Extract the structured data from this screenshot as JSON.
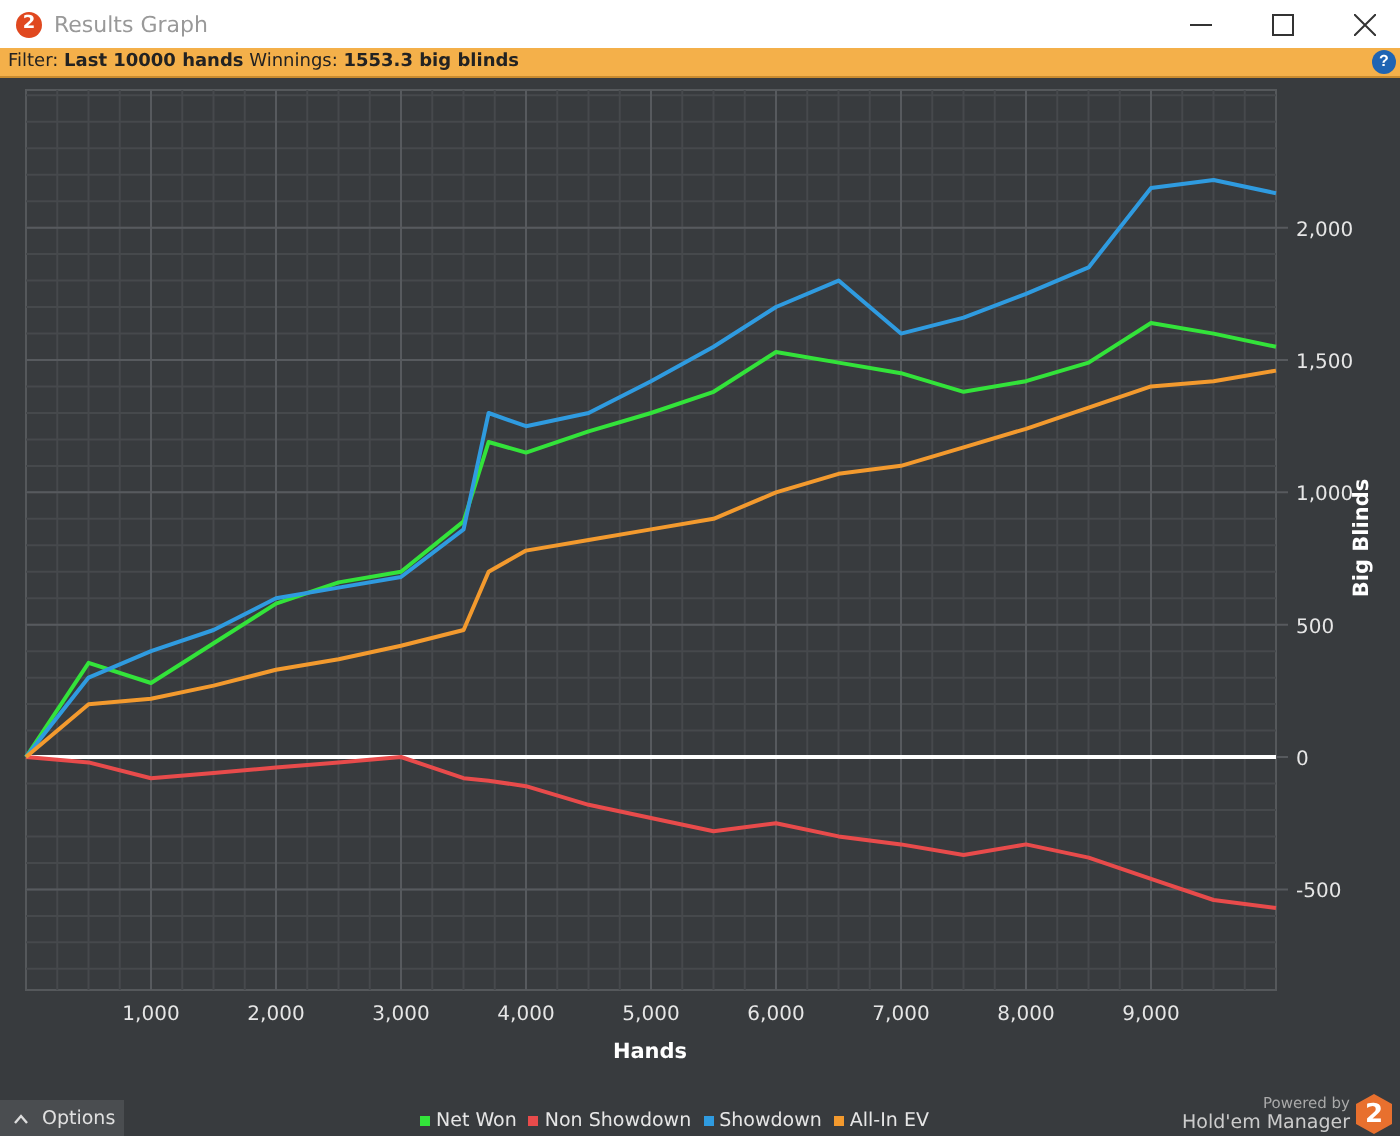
{
  "window": {
    "logo": "2",
    "title": "Results Graph"
  },
  "filter_bar": {
    "text": "Filter: **Last 10000 hands** Winnings: **1553.3 big blinds**",
    "help": "?"
  },
  "chart": {
    "chart_data": {
      "type": "line",
      "xlabel": "Hands",
      "ylabel": "Big Blinds",
      "x": [
        0,
        500,
        1000,
        1500,
        2000,
        2500,
        3000,
        3500,
        3700,
        4000,
        4500,
        5000,
        5500,
        6000,
        6500,
        7000,
        7500,
        8000,
        8500,
        9000,
        9500,
        10000
      ],
      "series": [
        {
          "name": "Net Won",
          "color": "#33e33a",
          "values": [
            0,
            356,
            280,
            430,
            580,
            660,
            700,
            890,
            1190,
            1150,
            1230,
            1300,
            1380,
            1530,
            1490,
            1450,
            1380,
            1420,
            1490,
            1640,
            1600,
            1550
          ]
        },
        {
          "name": "Non Showdown",
          "color": "#e84b4b",
          "values": [
            0,
            -20,
            -80,
            -60,
            -40,
            -20,
            0,
            -80,
            -90,
            -110,
            -180,
            -230,
            -280,
            -250,
            -300,
            -330,
            -370,
            -330,
            -380,
            -460,
            -540,
            -570
          ]
        },
        {
          "name": "Showdown",
          "color": "#2f9be0",
          "values": [
            0,
            300,
            400,
            480,
            600,
            640,
            680,
            860,
            1300,
            1250,
            1300,
            1420,
            1550,
            1700,
            1800,
            1600,
            1660,
            1750,
            1850,
            2150,
            2180,
            2130
          ]
        },
        {
          "name": "All-In EV",
          "color": "#f39a2e",
          "values": [
            0,
            200,
            220,
            270,
            330,
            370,
            420,
            480,
            700,
            780,
            820,
            860,
            900,
            1000,
            1070,
            1100,
            1170,
            1240,
            1320,
            1400,
            1420,
            1460
          ]
        }
      ],
      "grid": true,
      "xlim": [
        0,
        10000
      ],
      "ylim": [
        -880,
        2520
      ],
      "xticks": [
        {
          "value": 1000,
          "label": "1,000"
        },
        {
          "value": 2000,
          "label": "2,000"
        },
        {
          "value": 3000,
          "label": "3,000"
        },
        {
          "value": 4000,
          "label": "4,000"
        },
        {
          "value": 5000,
          "label": "5,000"
        },
        {
          "value": 6000,
          "label": "6,000"
        },
        {
          "value": 7000,
          "label": "7,000"
        },
        {
          "value": 8000,
          "label": "8,000"
        },
        {
          "value": 9000,
          "label": "9,000"
        }
      ],
      "yticks": [
        {
          "value": -500,
          "label": "-500"
        },
        {
          "value": 0,
          "label": "0"
        },
        {
          "value": 500,
          "label": "500"
        },
        {
          "value": 1000,
          "label": "1,000"
        },
        {
          "value": 1500,
          "label": "1,500"
        },
        {
          "value": 2000,
          "label": "2,000"
        }
      ]
    }
  },
  "options_button": {
    "label": "Options"
  },
  "branding": {
    "powered_by": "Powered by",
    "product": "Hold'em Manager",
    "logo": "2"
  }
}
